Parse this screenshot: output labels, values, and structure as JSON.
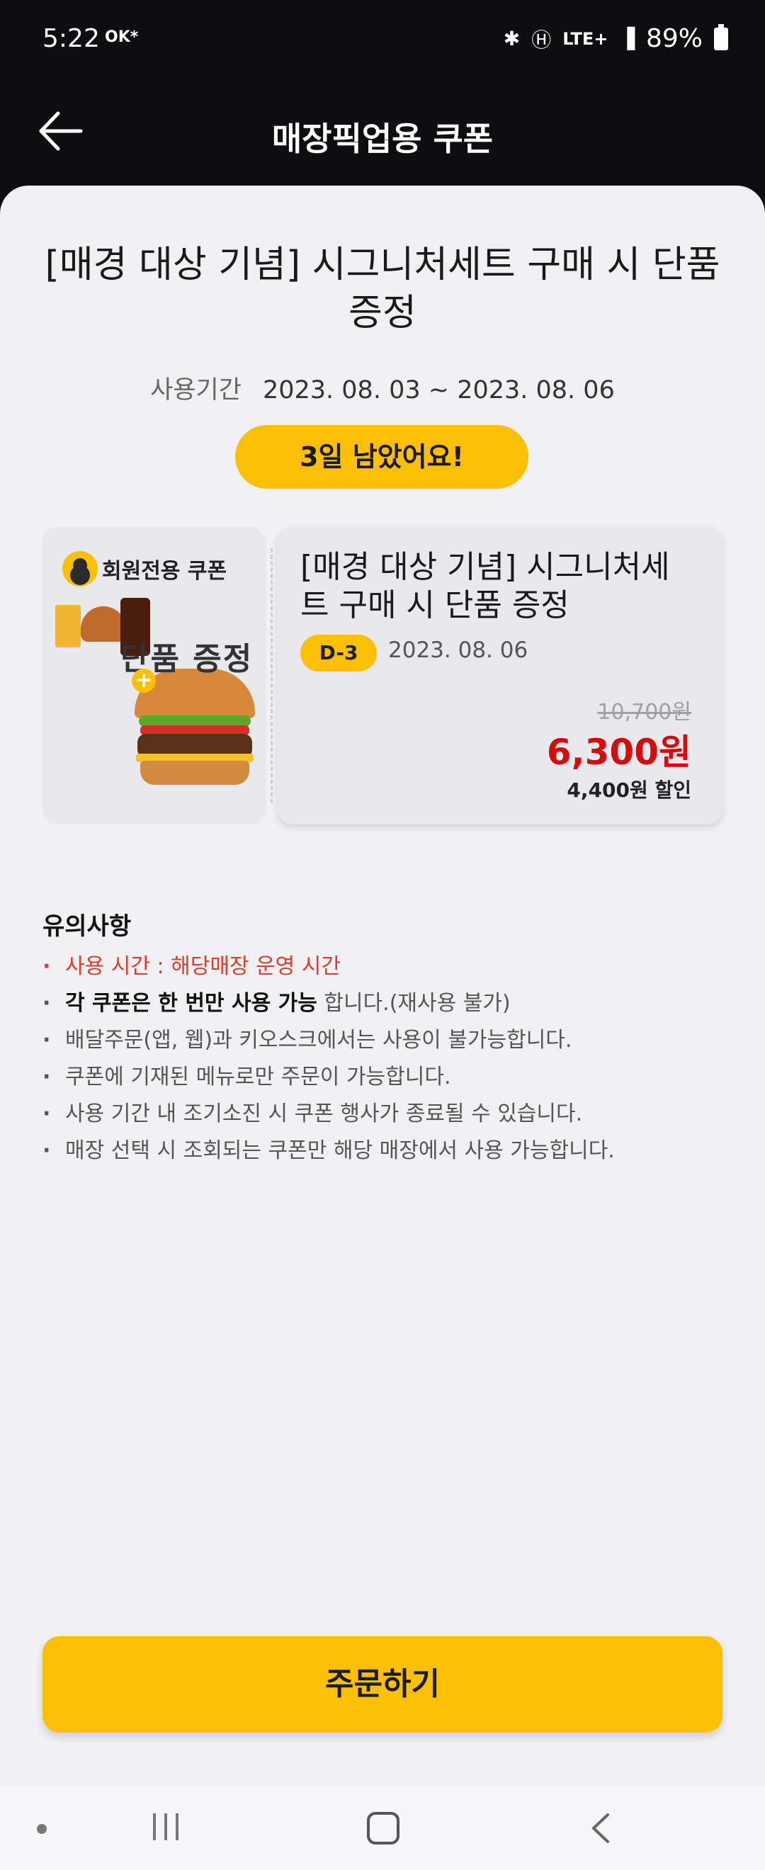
{
  "status_bar": {
    "time": "5:22",
    "carrier": "OK*",
    "network": "LTE+",
    "battery": "89%",
    "icons": [
      "bluetooth-icon",
      "hd-icon",
      "signal-icon",
      "battery-icon"
    ]
  },
  "header": {
    "title": "매장픽업용 쿠폰",
    "back_icon": "arrow-left-icon"
  },
  "coupon": {
    "title": "[매경 대상 기념] 시그니처세트 구매 시 단품 증정",
    "period_label": "사용기간",
    "period_value": "2023. 08. 03 ~ 2023. 08. 06",
    "remaining": "3일 남았어요!"
  },
  "ticket": {
    "member_label": "회원전용 쿠폰",
    "image_text": "단품 증정",
    "name": "[매경 대상 기념] 시그니처세트 구매 시 단품 증정",
    "dday": "D-3",
    "expiry": "2023. 08. 06",
    "original_price": "10,700원",
    "sale_price": "6,300원",
    "discount": "4,400원 할인"
  },
  "notes": {
    "title": "유의사항",
    "items": [
      {
        "text": "사용 시간 : 해당매장 운영 시간"
      },
      {
        "bold": "각 쿠폰은 한 번만 사용 가능",
        "text": " 합니다.(재사용 불가)"
      },
      {
        "text": "배달주문(앱, 웹)과 키오스크에서는 사용이 불가능합니다."
      },
      {
        "text": "쿠폰에 기재된 메뉴로만 주문이 가능합니다."
      },
      {
        "text": "사용 기간 내 조기소진 시 쿠폰 행사가 종료될 수 있습니다."
      },
      {
        "text": "매장 선택 시 조회되는 쿠폰만 해당 매장에서 사용 가능합니다."
      }
    ]
  },
  "order_button": "주문하기",
  "colors": {
    "accent": "#fbbf05",
    "price_red": "#d40c0c",
    "note_red": "#e03a2a",
    "header_bg": "#0e0e10",
    "sheet_bg": "#f1f1f3"
  }
}
